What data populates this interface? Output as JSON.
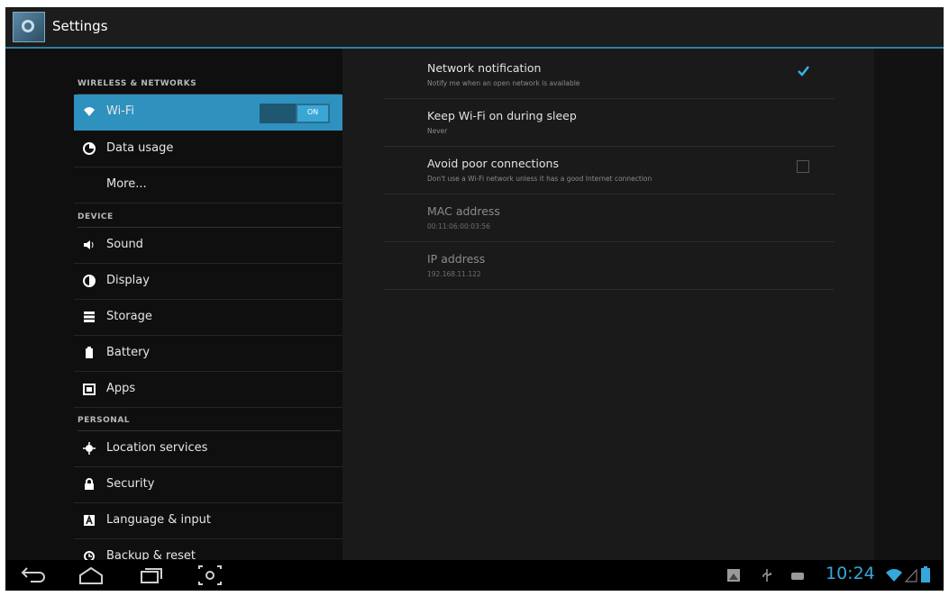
{
  "app": {
    "title": "Settings"
  },
  "sidebar": {
    "sections": [
      {
        "header": "WIRELESS & NETWORKS"
      },
      {
        "header": "DEVICE"
      },
      {
        "header": "PERSONAL"
      }
    ],
    "items": [
      {
        "label": "Wi-Fi",
        "toggle": "ON",
        "selected": true
      },
      {
        "label": "Data usage"
      },
      {
        "label": "More..."
      },
      {
        "label": "Sound"
      },
      {
        "label": "Display"
      },
      {
        "label": "Storage"
      },
      {
        "label": "Battery"
      },
      {
        "label": "Apps"
      },
      {
        "label": "Location services"
      },
      {
        "label": "Security"
      },
      {
        "label": "Language & input"
      },
      {
        "label": "Backup & reset"
      }
    ]
  },
  "prefs": [
    {
      "title": "Network notification",
      "summary": "Notify me when an open network is available",
      "checked": true
    },
    {
      "title": "Keep Wi-Fi on during sleep",
      "summary": "Never"
    },
    {
      "title": "Avoid poor connections",
      "summary": "Don't use a Wi-Fi network unless it has a good Internet connection",
      "checked": false
    },
    {
      "title": "MAC address",
      "summary": "00:11:06:00:03:56"
    },
    {
      "title": "IP address",
      "summary": "192.168.11.122"
    }
  ],
  "statusbar": {
    "time": "10:24"
  },
  "colors": {
    "accent": "#33b5e5",
    "selected_bg": "#2f91bd",
    "background": "#121212"
  }
}
